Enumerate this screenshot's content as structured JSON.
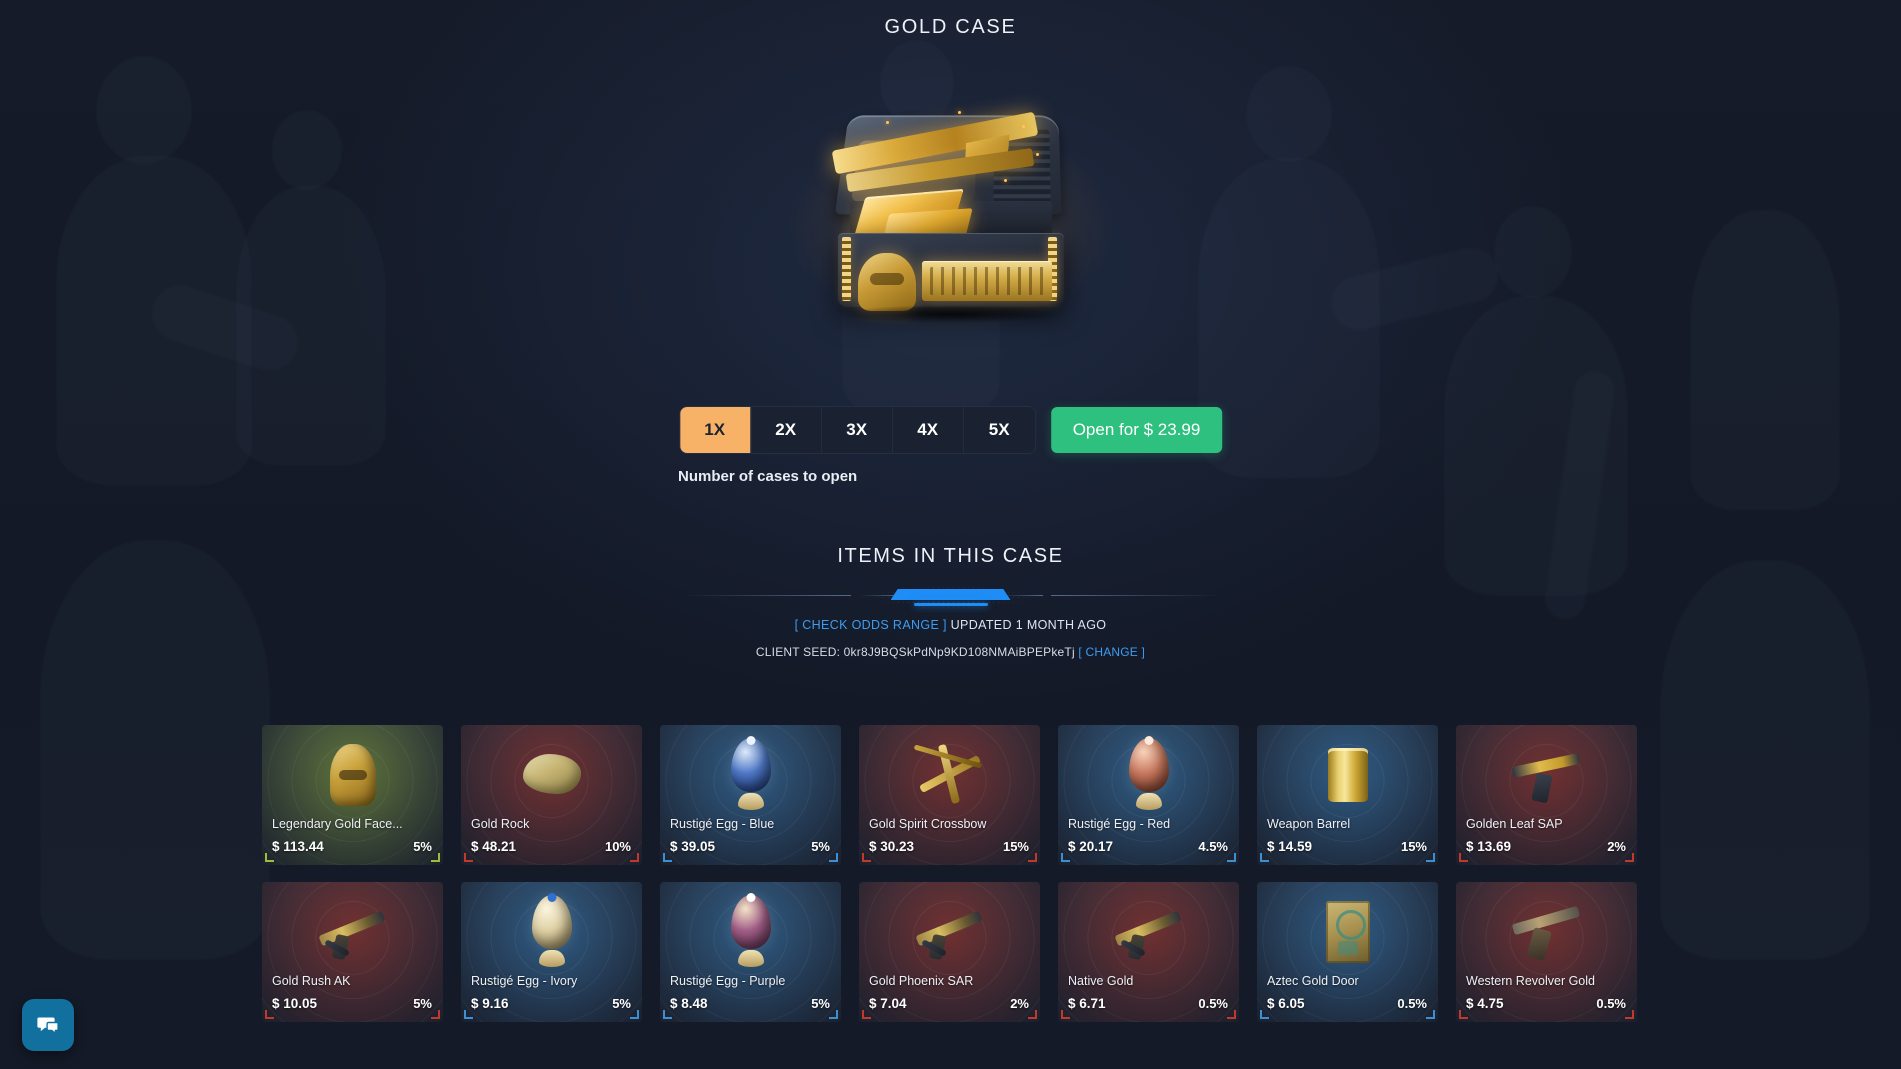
{
  "page": {
    "title": "GOLD CASE",
    "case_icon": "treasure-chest-gold"
  },
  "opener": {
    "multipliers": [
      {
        "label": "1X",
        "active": true
      },
      {
        "label": "2X",
        "active": false
      },
      {
        "label": "3X",
        "active": false
      },
      {
        "label": "4X",
        "active": false
      },
      {
        "label": "5X",
        "active": false
      }
    ],
    "open_button": "Open for $ 23.99",
    "caption": "Number of cases to open"
  },
  "items_section": {
    "heading": "ITEMS IN THIS CASE",
    "odds_link": "[ CHECK ODDS RANGE ]",
    "odds_updated": "UPDATED 1 MONTH AGO",
    "client_seed_label": "CLIENT SEED:",
    "client_seed_value": "0kr8J9BQSkPdNp9KD108NMAiBPEPkeTj",
    "change_link": "[ CHANGE ]"
  },
  "colors": {
    "accent_blue": "#1f8df5",
    "accent_green": "#2ec07f",
    "accent_orange": "#f7b267",
    "link": "#3f9cf0",
    "background": "#141a28",
    "chat_button": "#12709f"
  },
  "items": [
    {
      "name": "Legendary Gold Face...",
      "price": "$ 113.44",
      "odds": "5%",
      "rarity": "#9bbf3d",
      "art": "mask"
    },
    {
      "name": "Gold Rock",
      "price": "$ 48.21",
      "odds": "10%",
      "rarity": "#c0392b",
      "art": "rock"
    },
    {
      "name": "Rustigé Egg - Blue",
      "price": "$ 39.05",
      "odds": "5%",
      "rarity": "#3d8fd1",
      "art": "egg-blue"
    },
    {
      "name": "Gold Spirit Crossbow",
      "price": "$ 30.23",
      "odds": "15%",
      "rarity": "#c0392b",
      "art": "crossbow"
    },
    {
      "name": "Rustigé Egg - Red",
      "price": "$ 20.17",
      "odds": "4.5%",
      "rarity": "#3d8fd1",
      "art": "egg-red"
    },
    {
      "name": "Weapon Barrel",
      "price": "$ 14.59",
      "odds": "15%",
      "rarity": "#3d8fd1",
      "art": "barrel"
    },
    {
      "name": "Golden Leaf SAP",
      "price": "$ 13.69",
      "odds": "2%",
      "rarity": "#c0392b",
      "art": "pistol"
    },
    {
      "name": "Gold Rush AK",
      "price": "$ 10.05",
      "odds": "5%",
      "rarity": "#c0392b",
      "art": "rifle"
    },
    {
      "name": "Rustigé Egg - Ivory",
      "price": "$ 9.16",
      "odds": "5%",
      "rarity": "#3d8fd1",
      "art": "egg-ivory"
    },
    {
      "name": "Rustigé Egg - Purple",
      "price": "$ 8.48",
      "odds": "5%",
      "rarity": "#3d8fd1",
      "art": "egg-purple"
    },
    {
      "name": "Gold Phoenix SAR",
      "price": "$ 7.04",
      "odds": "2%",
      "rarity": "#c0392b",
      "art": "rifle"
    },
    {
      "name": "Native Gold",
      "price": "$ 6.71",
      "odds": "0.5%",
      "rarity": "#c0392b",
      "art": "rifle"
    },
    {
      "name": "Aztec Gold Door",
      "price": "$ 6.05",
      "odds": "0.5%",
      "rarity": "#3d8fd1",
      "art": "door"
    },
    {
      "name": "Western Revolver Gold",
      "price": "$ 4.75",
      "odds": "0.5%",
      "rarity": "#c0392b",
      "art": "revolver"
    }
  ],
  "chat": {
    "icon": "chat-bubbles-icon"
  }
}
